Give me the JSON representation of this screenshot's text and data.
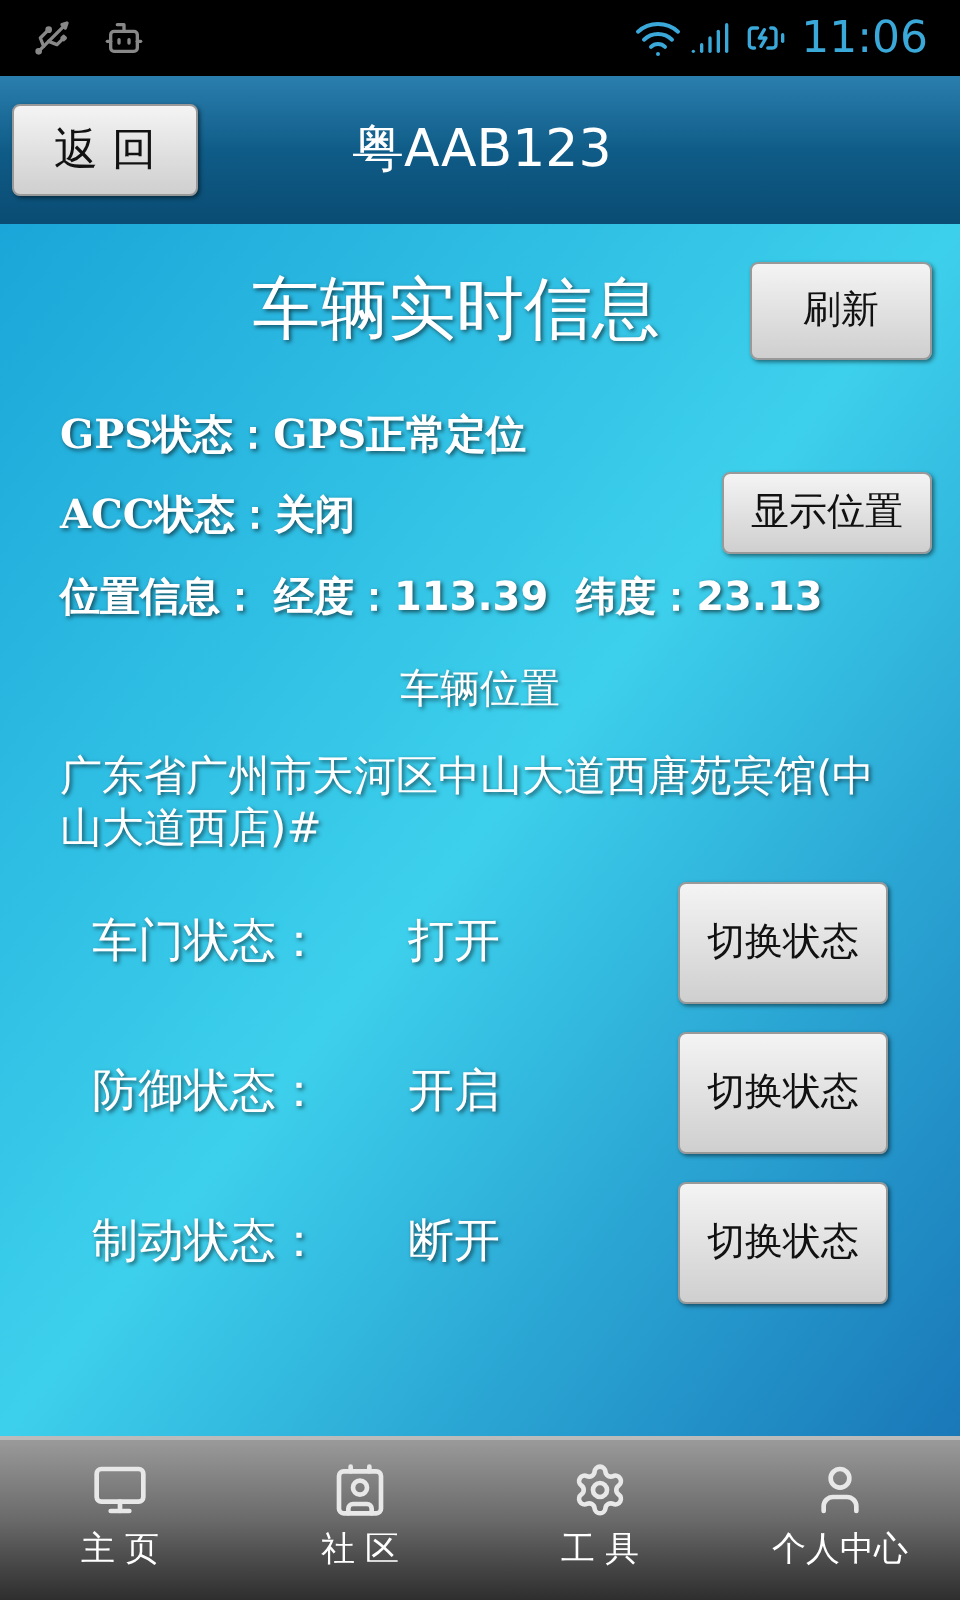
{
  "status_bar": {
    "time": "11:06"
  },
  "header": {
    "back_button": "返 回",
    "title": "粤AAB123"
  },
  "panel": {
    "title": "车辆实时信息",
    "refresh_button": "刷新",
    "gps": "GPS状态：GPS正常定位",
    "acc": "ACC状态：关闭",
    "show_location_button": "显示位置",
    "position": "位置信息： 经度：113.39  纬度：23.13",
    "location_heading": "车辆位置",
    "address": "广东省广州市天河区中山大道西唐苑宾馆(中山大道西店)#"
  },
  "states": [
    {
      "label": "车门状态：",
      "value": "打开",
      "button": "切换状态"
    },
    {
      "label": "防御状态：",
      "value": "开启",
      "button": "切换状态"
    },
    {
      "label": "制动状态：",
      "value": "断开",
      "button": "切换状态"
    }
  ],
  "nav": [
    {
      "kind": "home",
      "label": "主 页"
    },
    {
      "kind": "community",
      "label": "社 区"
    },
    {
      "kind": "tools",
      "label": "工 具"
    },
    {
      "kind": "profile",
      "label": "个人中心"
    }
  ]
}
